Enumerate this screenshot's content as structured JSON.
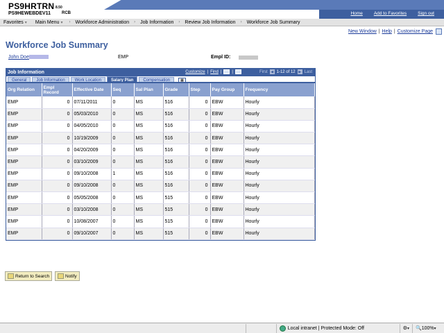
{
  "banner": {
    "app_name": "PS9HRTRN",
    "version": "8.50",
    "server": "PS9HEWEBDEV11",
    "db": "RCB",
    "links": [
      "Home",
      "Add to Favorites",
      "Sign out"
    ]
  },
  "menubar": {
    "items": [
      "Favorites",
      "Main Menu",
      "Workforce Administration",
      "Job Information",
      "Review Job Information",
      "Workforce Job Summary"
    ]
  },
  "pagelinks": {
    "new_window": "New Window",
    "help": "Help",
    "customize_page": "Customize Page"
  },
  "page_title": "Workforce Job Summary",
  "employee": {
    "name": "John Doe",
    "type": "EMP",
    "emplid_label": "Empl ID:"
  },
  "grid": {
    "title": "Job Information",
    "customize": "Customize",
    "find": "Find",
    "first": "First",
    "range": "1-12 of 12",
    "last": "Last",
    "tabs": [
      "General",
      "Job Information",
      "Work Location",
      "Salary Plan",
      "Compensation"
    ],
    "active_tab": "Salary Plan",
    "columns": [
      "Org Relation",
      "Empl Record",
      "Effective Date",
      "Seq",
      "Sal Plan",
      "Grade",
      "Step",
      "Pay Group",
      "Frequency"
    ],
    "rows": [
      [
        "EMP",
        "0",
        "07/11/2011",
        "0",
        "MS",
        "516",
        "0",
        "EBW",
        "Hourly"
      ],
      [
        "EMP",
        "0",
        "05/03/2010",
        "0",
        "MS",
        "516",
        "0",
        "EBW",
        "Hourly"
      ],
      [
        "EMP",
        "0",
        "04/05/2010",
        "0",
        "MS",
        "516",
        "0",
        "EBW",
        "Hourly"
      ],
      [
        "EMP",
        "0",
        "10/19/2009",
        "0",
        "MS",
        "516",
        "0",
        "EBW",
        "Hourly"
      ],
      [
        "EMP",
        "0",
        "04/20/2009",
        "0",
        "MS",
        "516",
        "0",
        "EBW",
        "Hourly"
      ],
      [
        "EMP",
        "0",
        "03/10/2009",
        "0",
        "MS",
        "516",
        "0",
        "EBW",
        "Hourly"
      ],
      [
        "EMP",
        "0",
        "09/10/2008",
        "1",
        "MS",
        "516",
        "0",
        "EBW",
        "Hourly"
      ],
      [
        "EMP",
        "0",
        "09/10/2008",
        "0",
        "MS",
        "516",
        "0",
        "EBW",
        "Hourly"
      ],
      [
        "EMP",
        "0",
        "05/05/2008",
        "0",
        "MS",
        "515",
        "0",
        "EBW",
        "Hourly"
      ],
      [
        "EMP",
        "0",
        "03/10/2008",
        "0",
        "MS",
        "515",
        "0",
        "EBW",
        "Hourly"
      ],
      [
        "EMP",
        "0",
        "10/08/2007",
        "0",
        "MS",
        "515",
        "0",
        "EBW",
        "Hourly"
      ],
      [
        "EMP",
        "0",
        "09/10/2007",
        "0",
        "MS",
        "515",
        "0",
        "EBW",
        "Hourly"
      ]
    ]
  },
  "buttons": {
    "return_to_search": "Return to Search",
    "notify": "Notify"
  },
  "statusbar": {
    "zone": "Local intranet | Protected Mode: Off",
    "zoom": "100%"
  }
}
